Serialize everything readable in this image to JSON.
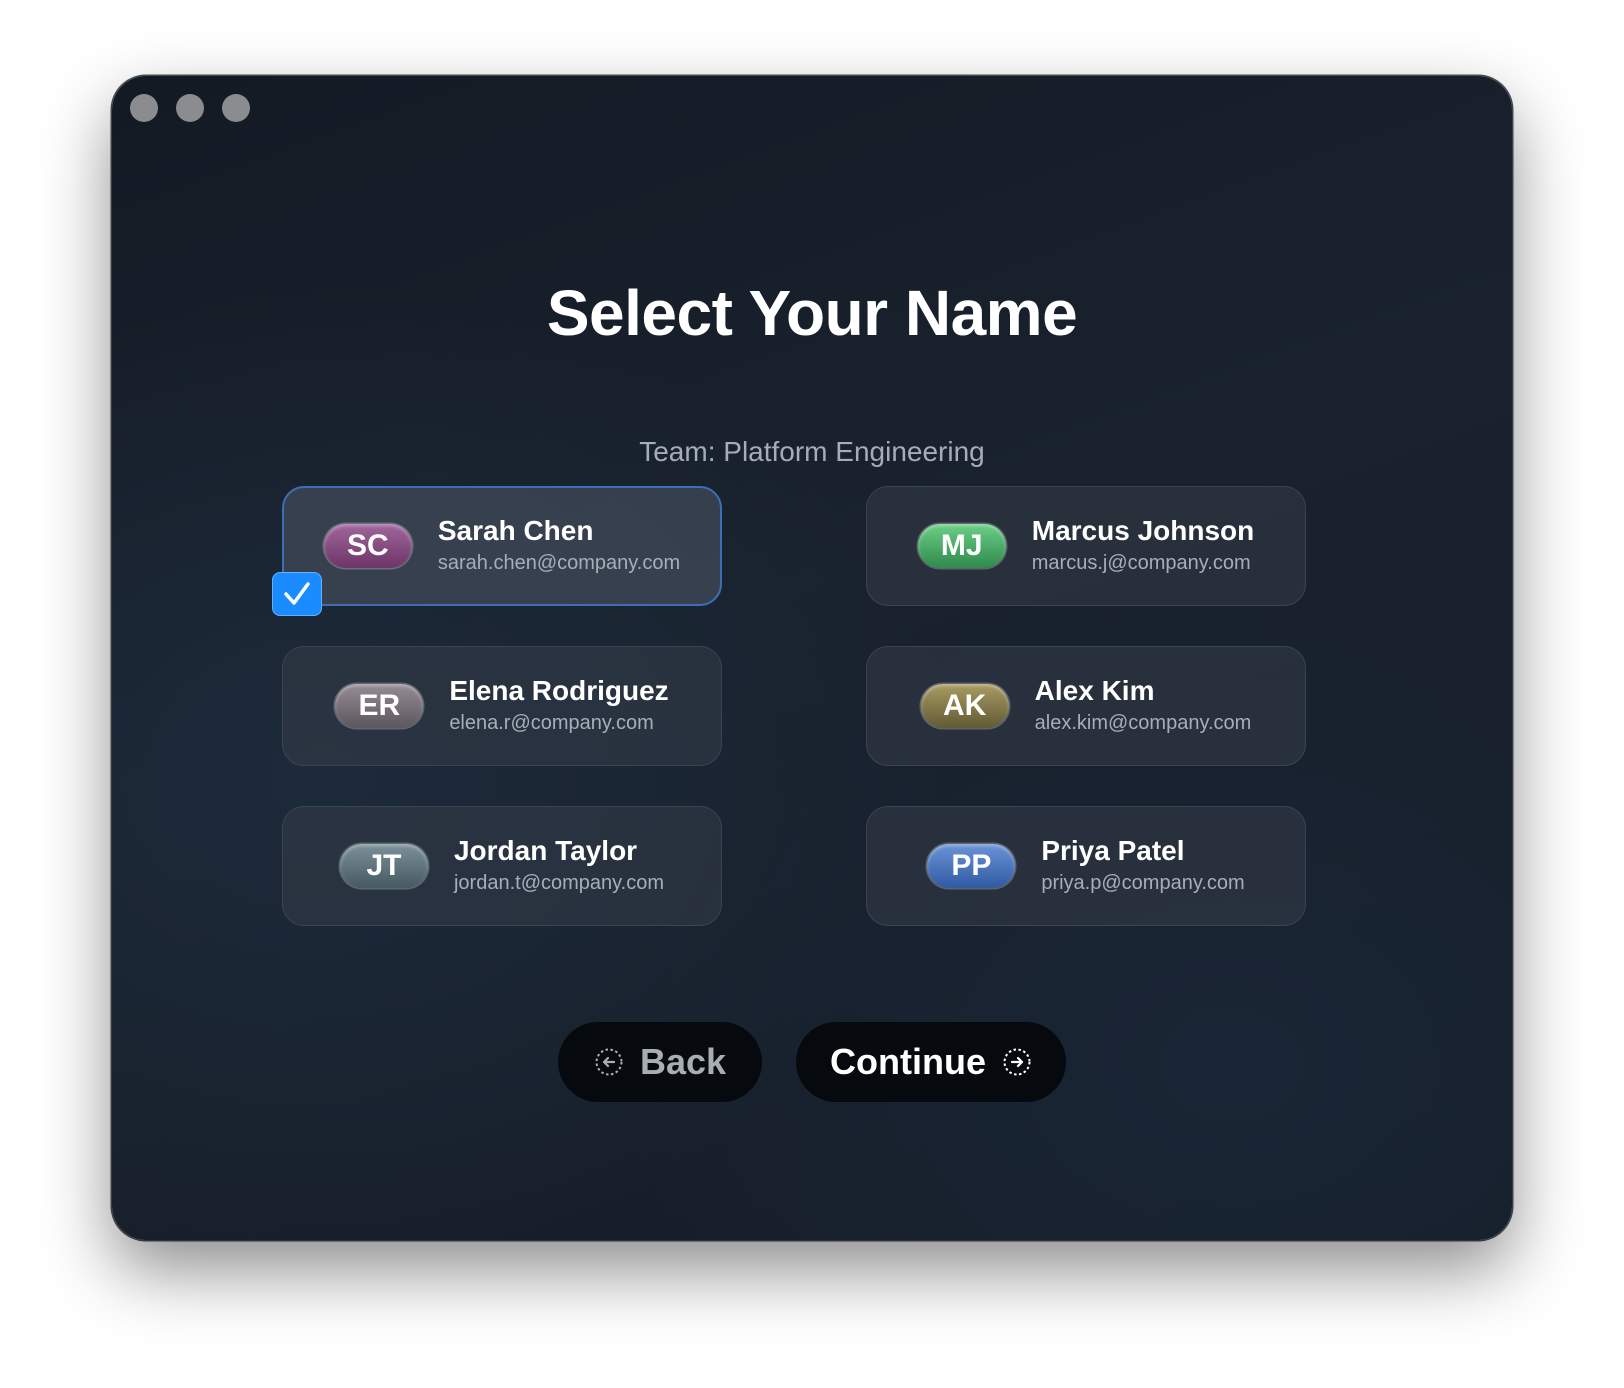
{
  "window": {
    "controls": [
      "close",
      "minimize",
      "zoom"
    ]
  },
  "page": {
    "title": "Select Your Name",
    "subtitle": "Team: Platform Engineering"
  },
  "users": [
    {
      "initials": "SC",
      "name": "Sarah Chen",
      "email": "sarah.chen@company.com",
      "avatar_color": "#7a3f78",
      "selected": true
    },
    {
      "initials": "MJ",
      "name": "Marcus Johnson",
      "email": "marcus.j@company.com",
      "avatar_color": "#3ea35e",
      "selected": false
    },
    {
      "initials": "ER",
      "name": "Elena Rodriguez",
      "email": "elena.r@company.com",
      "avatar_color": "#6e6670",
      "selected": false
    },
    {
      "initials": "AK",
      "name": "Alex Kim",
      "email": "alex.kim@company.com",
      "avatar_color": "#7a7246",
      "selected": false
    },
    {
      "initials": "JT",
      "name": "Jordan Taylor",
      "email": "jordan.t@company.com",
      "avatar_color": "#566a72",
      "selected": false
    },
    {
      "initials": "PP",
      "name": "Priya Patel",
      "email": "priya.p@company.com",
      "avatar_color": "#3d68b0",
      "selected": false
    }
  ],
  "actions": {
    "back_label": "Back",
    "back_icon": "arrow-left-circle-icon",
    "continue_label": "Continue",
    "continue_icon": "arrow-right-circle-icon"
  },
  "colors": {
    "accent": "#1a8cff",
    "selected_border": "#3c6fb5"
  }
}
